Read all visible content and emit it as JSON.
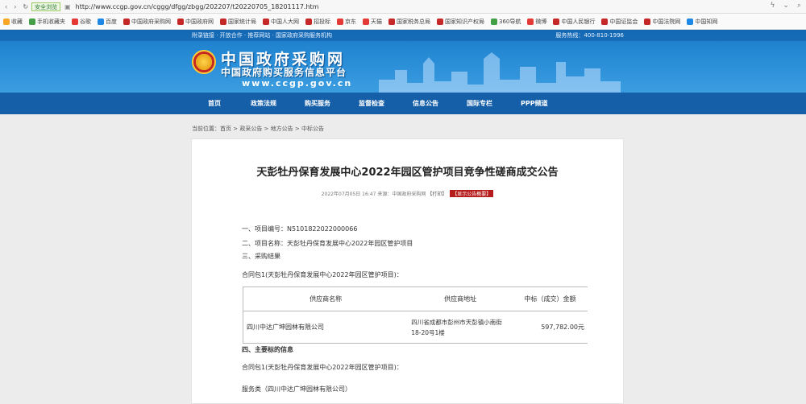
{
  "browser": {
    "secure_label": "安全浏览",
    "url": "http://www.ccgp.gov.cn/cggg/dfgg/zbgg/202207/t20220705_18201117.htm",
    "bookmarks": [
      {
        "label": "收藏",
        "color": "#f9a825"
      },
      {
        "label": "手机收藏夹",
        "color": "#43a047"
      },
      {
        "label": "谷歌",
        "color": "#e53935"
      },
      {
        "label": "百度",
        "color": "#1e88e5"
      },
      {
        "label": "中国政府采购网",
        "color": "#c62828"
      },
      {
        "label": "中国政府网",
        "color": "#c62828"
      },
      {
        "label": "国家统计局",
        "color": "#c62828"
      },
      {
        "label": "中国人大网",
        "color": "#c62828"
      },
      {
        "label": "招投标",
        "color": "#c62828"
      },
      {
        "label": "京东",
        "color": "#e53935"
      },
      {
        "label": "天猫",
        "color": "#e53935"
      },
      {
        "label": "国家税务总局",
        "color": "#c62828"
      },
      {
        "label": "国家知识产权局",
        "color": "#c62828"
      },
      {
        "label": "360导航",
        "color": "#43a047"
      },
      {
        "label": "微博",
        "color": "#e53935"
      },
      {
        "label": "中国人民银行",
        "color": "#c62828"
      },
      {
        "label": "中国证监会",
        "color": "#c62828"
      },
      {
        "label": "中国法院网",
        "color": "#c62828"
      },
      {
        "label": "中国知网",
        "color": "#1e88e5"
      }
    ]
  },
  "site": {
    "topline_left": "附录链接 · 开放合作 · 推荐网站 · 国家政府采购服务机构",
    "hotline": "服务热线：400-810-1996",
    "logo_cn": "中国政府采购网",
    "logo_sub": "中国政府购买服务信息平台",
    "logo_url": "www.ccgp.gov.cn"
  },
  "nav": [
    "首页",
    "政策法规",
    "购买服务",
    "监督检查",
    "信息公告",
    "国际专栏",
    "PPP频道"
  ],
  "breadcrumb": {
    "prefix": "当前位置：",
    "items": [
      "首页",
      "政采公告",
      "地方公告",
      "中标公告"
    ]
  },
  "article": {
    "title": "天彭牡丹保育发展中心2022年园区管护项目竞争性磋商成交公告",
    "meta": "2022年07月05日 16:47 来源：中国政府采购网",
    "print_label": "【打印】",
    "warn_label": "【显示公告概要】",
    "lines": [
      "一、项目编号：N5101822022000066",
      "二、项目名称：天彭牡丹保育发展中心2022年园区管护项目",
      "三、采购结果",
      "合同包1(天彭牡丹保育发展中心2022年园区管护项目)："
    ],
    "table": {
      "headers": [
        "供应商名称",
        "供应商地址",
        "中标（成交）金额"
      ],
      "rows": [
        [
          "四川中达广坤园林有限公司",
          "四川省成都市彭州市天彭镇小南街18-20号1楼",
          "597,782.00元"
        ]
      ]
    },
    "after_lines": [
      "四、主要标的信息",
      "合同包1(天彭牡丹保育发展中心2022年园区管护项目)：",
      "服务类（四川中达广坤园林有限公司）"
    ]
  }
}
